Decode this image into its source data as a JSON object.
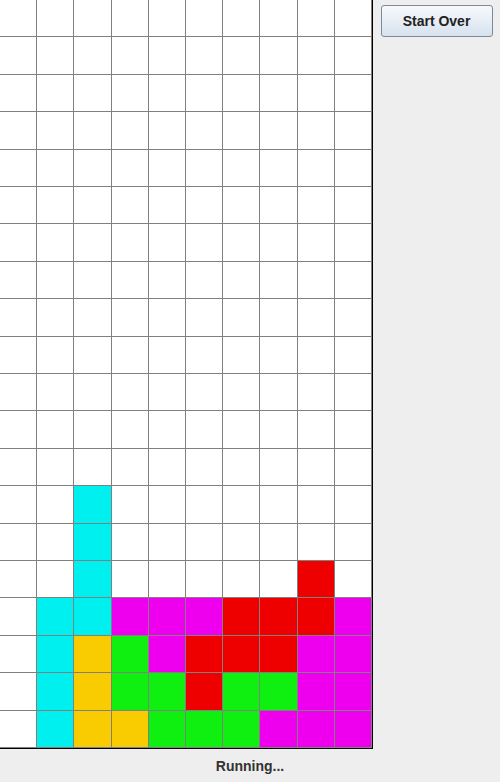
{
  "board": {
    "rows": [
      [
        null,
        null,
        null,
        null,
        null,
        null,
        null,
        null,
        null,
        null
      ],
      [
        null,
        null,
        null,
        null,
        null,
        null,
        null,
        null,
        null,
        null
      ],
      [
        null,
        null,
        null,
        null,
        null,
        null,
        null,
        null,
        null,
        null
      ],
      [
        null,
        null,
        null,
        null,
        null,
        null,
        null,
        null,
        null,
        null
      ],
      [
        null,
        null,
        null,
        null,
        null,
        null,
        null,
        null,
        null,
        null
      ],
      [
        null,
        null,
        null,
        null,
        null,
        null,
        null,
        null,
        null,
        null
      ],
      [
        null,
        null,
        null,
        null,
        null,
        null,
        null,
        null,
        null,
        null
      ],
      [
        null,
        null,
        null,
        null,
        null,
        null,
        null,
        null,
        null,
        null
      ],
      [
        null,
        null,
        null,
        null,
        null,
        null,
        null,
        null,
        null,
        null
      ],
      [
        null,
        null,
        null,
        null,
        null,
        null,
        null,
        null,
        null,
        null
      ],
      [
        null,
        null,
        null,
        null,
        null,
        null,
        null,
        null,
        null,
        null
      ],
      [
        null,
        null,
        null,
        null,
        null,
        null,
        null,
        null,
        null,
        null
      ],
      [
        null,
        null,
        null,
        null,
        null,
        null,
        null,
        null,
        null,
        null
      ],
      [
        null,
        null,
        "#00f0f0",
        null,
        null,
        null,
        null,
        null,
        null,
        null
      ],
      [
        null,
        null,
        "#00f0f0",
        null,
        null,
        null,
        null,
        null,
        null,
        null
      ],
      [
        null,
        null,
        "#00f0f0",
        null,
        null,
        null,
        null,
        null,
        "#ee0000",
        null
      ],
      [
        null,
        "#00f0f0",
        "#00f0f0",
        "#ee00ee",
        "#ee00ee",
        "#ee00ee",
        "#ee0000",
        "#ee0000",
        "#ee0000",
        "#ee00ee"
      ],
      [
        null,
        "#00f0f0",
        "#f8cc00",
        "#10f010",
        "#ee00ee",
        "#ee0000",
        "#ee0000",
        "#ee0000",
        "#ee00ee",
        "#ee00ee"
      ],
      [
        null,
        "#00f0f0",
        "#f8cc00",
        "#10f010",
        "#10f010",
        "#ee0000",
        "#10f010",
        "#10f010",
        "#ee00ee",
        "#ee00ee"
      ],
      [
        null,
        "#00f0f0",
        "#f8cc00",
        "#f8cc00",
        "#10f010",
        "#10f010",
        "#10f010",
        "#ee00ee",
        "#ee00ee",
        "#ee00ee"
      ]
    ]
  },
  "buttons": [
    {
      "label": "Start Over"
    }
  ],
  "status_bar": "Running..."
}
